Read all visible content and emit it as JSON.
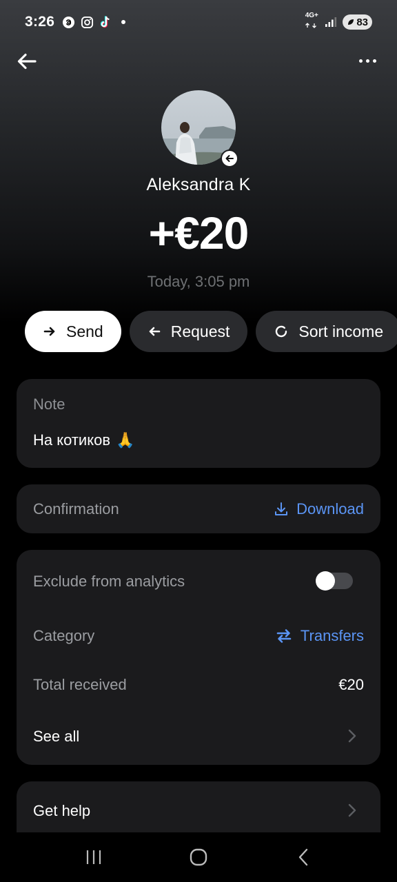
{
  "status_bar": {
    "time": "3:26",
    "network": "4G+",
    "battery": "83",
    "left_icons": [
      "threads-icon",
      "instagram-icon",
      "tiktok-icon",
      "notification-dot"
    ]
  },
  "header": {
    "back_icon": "arrow-left-icon",
    "more_icon": "more-horizontal-icon"
  },
  "transaction": {
    "contact_name": "Aleksandra K",
    "amount": "+€20",
    "datetime": "Today, 3:05 pm",
    "direction_icon": "arrow-left-icon"
  },
  "actions": [
    {
      "label": "Send",
      "icon": "arrow-right-icon"
    },
    {
      "label": "Request",
      "icon": "arrow-left-icon"
    },
    {
      "label": "Sort income",
      "icon": "refresh-icon"
    }
  ],
  "note": {
    "label": "Note",
    "text": "На котиков",
    "emoji": "🙏"
  },
  "confirmation": {
    "label": "Confirmation",
    "action_label": "Download",
    "action_icon": "download-icon"
  },
  "details": {
    "exclude_label": "Exclude from analytics",
    "exclude_on": false,
    "category_label": "Category",
    "category_value": "Transfers",
    "category_icon": "transfer-arrows-icon",
    "total_label": "Total received",
    "total_value": "€20",
    "see_all_label": "See all"
  },
  "help": {
    "label": "Get help"
  },
  "colors": {
    "accent_link": "#5b95f5",
    "card_bg": "#1b1b1d",
    "chip_bg": "#2a2b2e"
  }
}
